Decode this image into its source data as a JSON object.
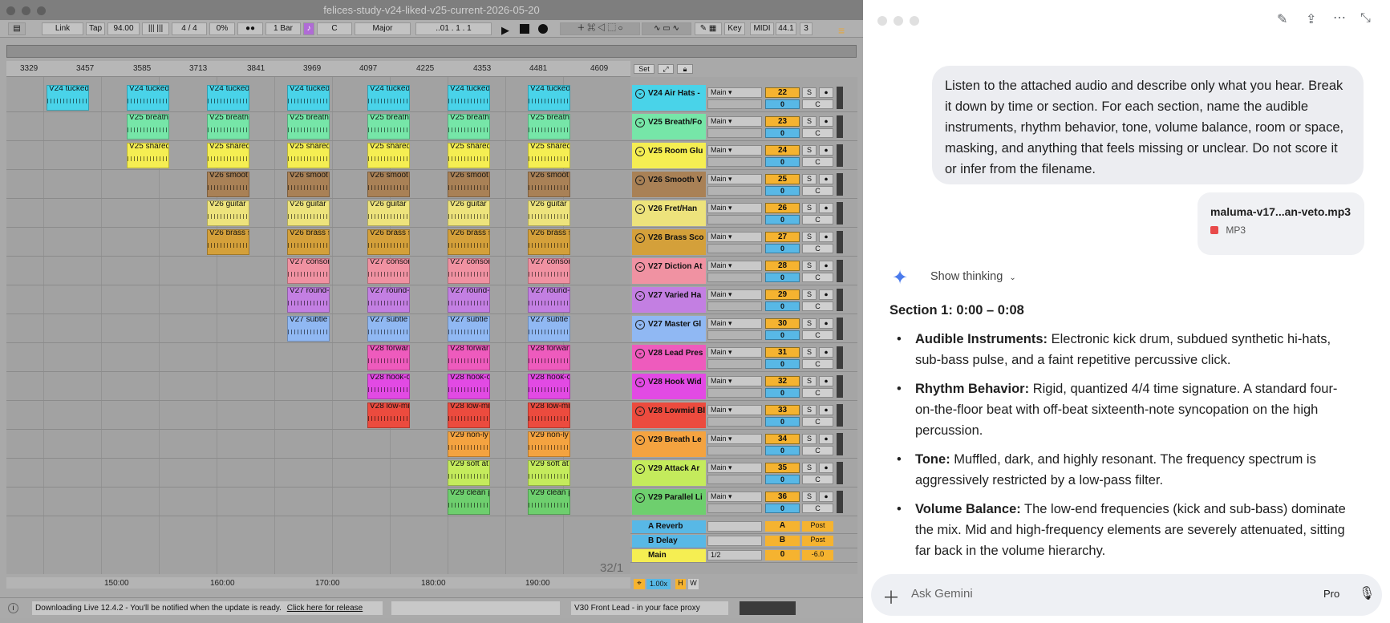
{
  "ableton": {
    "window_title": "felices-study-v24-liked-v25-current-2026-05-20",
    "control_bar": {
      "link": "Link",
      "tap": "Tap",
      "tempo": "94.00",
      "signature": "4 / 4",
      "swing": "0%",
      "quantize": "1 Bar",
      "key_root": "C",
      "scale": "Major",
      "position": "..01 .  1 .  1",
      "key_button": "Key",
      "midi_button": "MIDI",
      "sample_rate": "44.1",
      "cpu": "3"
    },
    "ruler_ticks": [
      "3329",
      "3457",
      "3585",
      "3713",
      "3841",
      "3969",
      "4097",
      "4225",
      "4353",
      "4481",
      "4609"
    ],
    "bottom_ruler": [
      "150:00",
      "160:00",
      "170:00",
      "180:00",
      "190:00"
    ],
    "set_label": "Set",
    "page_indicator": "32/1",
    "tracks": [
      {
        "name": "V24 Air Hats -",
        "clip": "V24 tucked",
        "num": "22",
        "color": "#49d3e9"
      },
      {
        "name": "V25 Breath/Fo",
        "clip": "V25 breath",
        "num": "23",
        "color": "#76e6a8"
      },
      {
        "name": "V25 Room Glu",
        "clip": "V25 shared",
        "num": "24",
        "color": "#f5ee52"
      },
      {
        "name": "V26 Smooth V",
        "clip": "V26 smoot",
        "num": "25",
        "color": "#a98156"
      },
      {
        "name": "V26 Fret/Han",
        "clip": "V26 guitar",
        "num": "26",
        "color": "#ede37c"
      },
      {
        "name": "V26 Brass Sco",
        "clip": "V26 brass s",
        "num": "27",
        "color": "#d4a03a"
      },
      {
        "name": "V27 Diction At",
        "clip": "V27 consor",
        "num": "28",
        "color": "#f092a2"
      },
      {
        "name": "V27 Varied Ha",
        "clip": "V27 round-",
        "num": "29",
        "color": "#c37fe2"
      },
      {
        "name": "V27 Master Gl",
        "clip": "V27 subtle",
        "num": "30",
        "color": "#90b8f3"
      },
      {
        "name": "V28 Lead Pres",
        "clip": "V28 forwar",
        "num": "31",
        "color": "#ee5bbd"
      },
      {
        "name": "V28 Hook Wid",
        "clip": "V28 hook-c",
        "num": "32",
        "color": "#e24ae4"
      },
      {
        "name": "V28 Lowmid Bl",
        "clip": "V28 low-mi",
        "num": "33",
        "color": "#ec4b3e"
      },
      {
        "name": "V29 Breath Le",
        "clip": "V29 non-ly",
        "num": "34",
        "color": "#f4a340"
      },
      {
        "name": "V29 Attack Ar",
        "clip": "V29 soft at",
        "num": "35",
        "color": "#c4eb5c"
      },
      {
        "name": "V29 Parallel Li",
        "clip": "V29 clean p",
        "num": "36",
        "color": "#6ecf6e"
      }
    ],
    "mixer_labels": {
      "route": "Main",
      "vol": "0",
      "pan": "C",
      "solo": "S"
    },
    "returns": [
      {
        "name": "A Reverb",
        "letter": "A",
        "post": "Post"
      },
      {
        "name": "B Delay",
        "letter": "B",
        "post": "Post"
      }
    ],
    "master": {
      "name": "Main",
      "route": "1/2",
      "vol": "0",
      "db": "-6.0"
    },
    "zoom": "1.00x",
    "status_message": "Downloading Live 12.4.2 - You'll be notified when the update is ready.",
    "status_link": "Click here for release",
    "status_track": "V30 Front Lead - in your face proxy"
  },
  "gemini": {
    "prompt": "Listen to the attached audio and describe only what you hear. Break it down by time or section. For each section, name the audible instruments, rhythm behavior, tone, volume balance, room or space, masking, and anything that feels missing or unclear. Do not score it or infer from the filename.",
    "file_name": "maluma-v17...an-veto.mp3",
    "file_type": "MP3",
    "show_thinking": "Show thinking",
    "section_title": "Section 1: 0:00 – 0:08",
    "bullets": [
      {
        "label": "Audible Instruments:",
        "text": "Electronic kick drum, subdued synthetic hi-hats, sub-bass pulse, and a faint repetitive percussive click."
      },
      {
        "label": "Rhythm Behavior:",
        "text": "Rigid, quantized 4/4 time signature. A standard four-on-the-floor beat with off-beat sixteenth-note syncopation on the high percussion."
      },
      {
        "label": "Tone:",
        "text": "Muffled, dark, and highly resonant. The frequency spectrum is aggressively restricted by a low-pass filter."
      },
      {
        "label": "Volume Balance:",
        "text": "The low-end frequencies (kick and sub-bass) dominate the mix. Mid and high-frequency elements are severely attenuated, sitting far back in the volume hierarchy."
      }
    ],
    "input_placeholder": "Ask Gemini",
    "mode": "Pro"
  }
}
